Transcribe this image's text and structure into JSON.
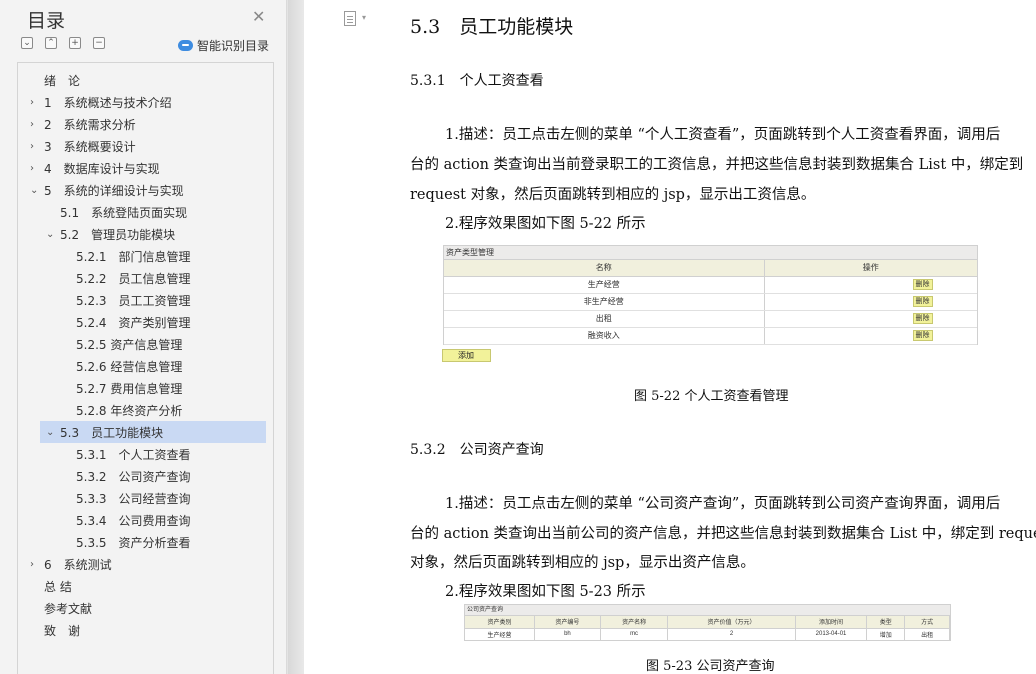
{
  "sidebar": {
    "title": "目录",
    "smart_label": "智能识别目录",
    "tool_buttons": [
      "⌄",
      "⌃",
      "+",
      "−"
    ],
    "items": [
      {
        "label": "绪　论",
        "arrow": "",
        "indent": 0
      },
      {
        "label": "1　系统概述与技术介绍",
        "arrow": "›",
        "indent": 0
      },
      {
        "label": "2　系统需求分析",
        "arrow": "›",
        "indent": 0
      },
      {
        "label": "3　系统概要设计",
        "arrow": "›",
        "indent": 0
      },
      {
        "label": "4　数据库设计与实现",
        "arrow": "›",
        "indent": 0
      },
      {
        "label": "5　系统的详细设计与实现",
        "arrow": "⌄",
        "indent": 0
      },
      {
        "label": "5.1　系统登陆页面实现",
        "arrow": "",
        "indent": 1
      },
      {
        "label": "5.2　管理员功能模块",
        "arrow": "⌄",
        "indent": 1
      },
      {
        "label": "5.2.1　部门信息管理",
        "arrow": "",
        "indent": 2
      },
      {
        "label": "5.2.2　员工信息管理",
        "arrow": "",
        "indent": 2
      },
      {
        "label": "5.2.3　员工工资管理",
        "arrow": "",
        "indent": 2
      },
      {
        "label": "5.2.4　资产类别管理",
        "arrow": "",
        "indent": 2
      },
      {
        "label": "5.2.5 资产信息管理",
        "arrow": "",
        "indent": 2
      },
      {
        "label": "5.2.6 经营信息管理",
        "arrow": "",
        "indent": 2
      },
      {
        "label": "5.2.7 费用信息管理",
        "arrow": "",
        "indent": 2
      },
      {
        "label": "5.2.8 年终资产分析",
        "arrow": "",
        "indent": 2
      },
      {
        "label": "5.3　员工功能模块",
        "arrow": "⌄",
        "indent": 1,
        "selected": true
      },
      {
        "label": "5.3.1　个人工资查看",
        "arrow": "",
        "indent": 2
      },
      {
        "label": "5.3.2　公司资产查询",
        "arrow": "",
        "indent": 2
      },
      {
        "label": "5.3.3　公司经营查询",
        "arrow": "",
        "indent": 2
      },
      {
        "label": "5.3.4　公司费用查询",
        "arrow": "",
        "indent": 2
      },
      {
        "label": "5.3.5　资产分析查看",
        "arrow": "",
        "indent": 2
      },
      {
        "label": "6　系统测试",
        "arrow": "›",
        "indent": 0
      },
      {
        "label": "总 结",
        "arrow": "",
        "indent": 0
      },
      {
        "label": "参考文献",
        "arrow": "",
        "indent": 0
      },
      {
        "label": "致　谢",
        "arrow": "",
        "indent": 0
      }
    ]
  },
  "doc": {
    "heading_53": "5.3　员工功能模块",
    "heading_531": "5.3.1　个人工资查看",
    "p531_line1": "1.描述：员工点击左侧的菜单 “个人工资查看”，页面跳转到个人工资查看界面，调用后",
    "p531_line2": "台的 action 类查询出当前登录职工的工资信息，并把这些信息封装到数据集合 List 中，绑定到",
    "p531_line3": "request 对象，然后页面跳转到相应的 jsp，显示出工资信息。",
    "p531_effect": "2.程序效果图如下图 5-22 所示",
    "fig522": {
      "title": "资产类型管理",
      "col_name": "名称",
      "col_op": "操作",
      "rows": [
        "生产经营",
        "非生产经营",
        "出租",
        "融资收入"
      ],
      "delete_label": "删除",
      "add_label": "添加",
      "caption": "图 5-22 个人工资查看管理"
    },
    "heading_532": "5.3.2　公司资产查询",
    "p532_line1": "1.描述：员工点击左侧的菜单 “公司资产查询”，页面跳转到公司资产查询界面，调用后",
    "p532_line2": "台的 action 类查询出当前公司的资产信息，并把这些信息封装到数据集合 List 中，绑定到 request",
    "p532_line3": "对象，然后页面跳转到相应的 jsp，显示出资产信息。",
    "p532_effect": "2.程序效果图如下图 5-23 所示",
    "fig523": {
      "title": "公司资产查询",
      "headers": [
        "资产类别",
        "资产编号",
        "资产名称",
        "资产价值（万元）",
        "添加时间",
        "类型",
        "方式"
      ],
      "row": [
        "生产经营",
        "bh",
        "mc",
        "2",
        "2013-04-01",
        "增加",
        "出租"
      ],
      "caption": "图 5-23 公司资产查询"
    }
  },
  "colors": {
    "sidebar_bg": "#f3f3f3",
    "selected_bg": "#c9d9f3",
    "table_header_bg": "#f1f0dd",
    "button_bg": "#f2f29a"
  }
}
